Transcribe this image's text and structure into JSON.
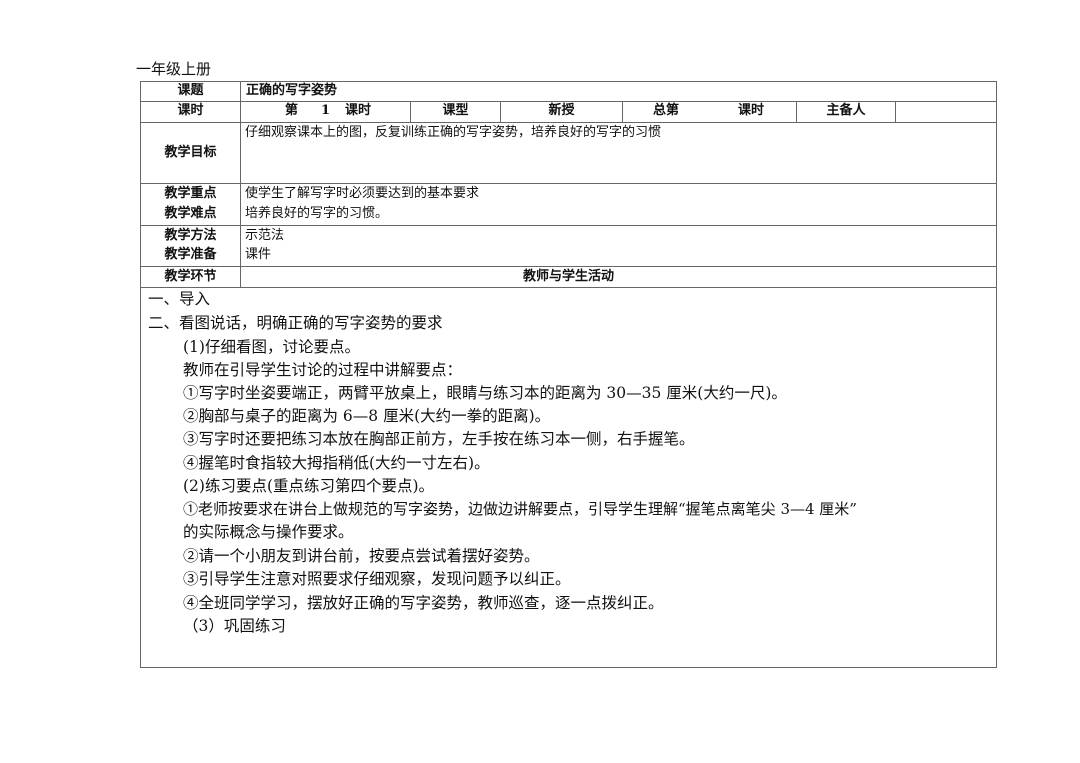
{
  "header": {
    "grade": "一年级上册"
  },
  "table": {
    "topic_label": "课题",
    "topic_value": "正确的写字姿势",
    "period_label": "课时",
    "period_di": "第",
    "period_num": "1",
    "period_unit": "课时",
    "type_label": "课型",
    "type_value": "新授",
    "total_label": "总第",
    "total_unit": "课时",
    "preparer_label": "主备人",
    "preparer_value": "",
    "goal_label": "教学目标",
    "goal_value": "仔细观察课本上的图，反复训练正确的写字姿势，培养良好的写字的习惯",
    "key_label": "教学重点",
    "key_value": "使学生了解写字时必须要达到的基本要求",
    "difficulty_label": "教学难点",
    "difficulty_value": "培养良好的写字的习惯。",
    "method_label": "教学方法",
    "method_value": "示范法",
    "prep_label": "教学准备",
    "prep_value": "课件",
    "stage_label": "教学环节",
    "activity_label": "教师与学生活动"
  },
  "content": {
    "lines": [
      "一、导入",
      "二、看图说话，明确正确的写字姿势的要求",
      "(1)仔细看图，讨论要点。",
      "教师在引导学生讨论的过程中讲解要点：",
      "①写字时坐姿要端正，两臂平放桌上，眼睛与练习本的距离为 30—35 厘米(大约一尺)。",
      "②胸部与桌子的距离为 6—8 厘米(大约一拳的距离)。",
      "③写字时还要把练习本放在胸部正前方，左手按在练习本一侧，右手握笔。",
      "④握笔时食指较大拇指稍低(大约一寸左右)。",
      "(2)练习要点(重点练习第四个要点)。",
      "①老师按要求在讲台上做规范的写字姿势，边做边讲解要点，引导学生理解“握笔点离笔尖 3—4 厘米”",
      "的实际概念与操作要求。",
      "②请一个小朋友到讲台前，按要点尝试着摆好姿势。",
      "③引导学生注意对照要求仔细观察，发现问题予以纠正。",
      "④全班同学学习，摆放好正确的写字姿势，教师巡查，逐一点拨纠正。",
      "（3）巩固练习"
    ]
  }
}
